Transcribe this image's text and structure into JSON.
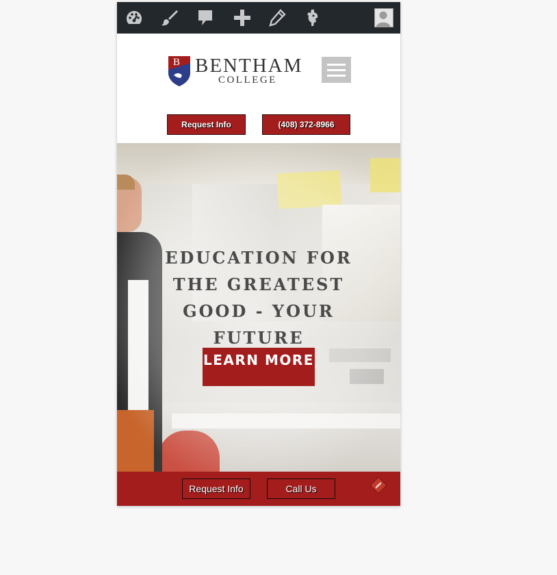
{
  "admin_bar": {
    "icons": [
      "dashboard-icon",
      "customize-brush-icon",
      "comments-icon",
      "new-plus-icon",
      "edit-pencil-icon",
      "plugin-icon",
      "user-avatar-icon"
    ]
  },
  "header": {
    "logo": {
      "name": "BENTHAM",
      "sub": "COLLEGE",
      "mark_letter": "B"
    },
    "menu_icon": "hamburger-menu-icon",
    "request_info_label": "Request Info",
    "phone_label": "(408) 372-8966"
  },
  "hero": {
    "headline": "EDUCATION FOR THE GREATEST GOOD - YOUR FUTURE",
    "cta_label": "LEARN MORE"
  },
  "footer_bar": {
    "request_info_label": "Request Info",
    "call_label": "Call Us",
    "feather_icon": "feather-icon"
  },
  "colors": {
    "brand_red": "#a31d1d",
    "admin_bar": "#23282d",
    "page_bg": "#f7f7f7"
  }
}
